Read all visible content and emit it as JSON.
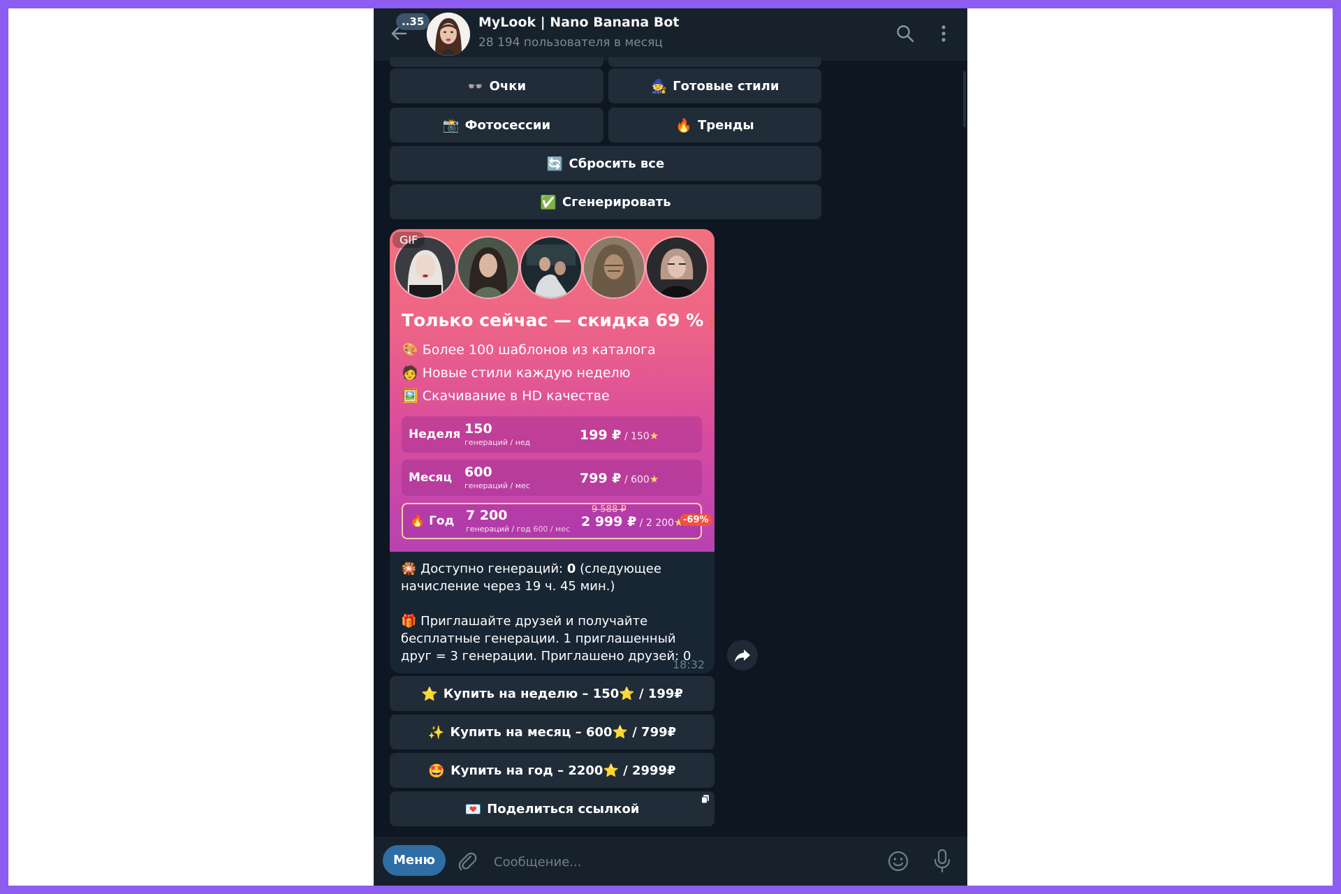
{
  "header": {
    "back_icon": "arrow-left-icon",
    "unread_count": "..35",
    "title": "MyLook | Nano Banana Bot",
    "subtitle": "28 194 пользователя в месяц",
    "search_icon": "search-icon",
    "more_icon": "vertical-dots-icon"
  },
  "keyboard_top": [
    {
      "emoji": "👓",
      "label": "Очки"
    },
    {
      "emoji": "🧙",
      "label": "Готовые стили"
    },
    {
      "emoji": "📸",
      "label": "Фотосессии"
    },
    {
      "emoji": "🔥",
      "label": "Тренды"
    },
    {
      "emoji": "🔄",
      "label": "Сбросить все"
    },
    {
      "emoji": "✅",
      "label": "Сгенерировать"
    }
  ],
  "message": {
    "gif_label": "GIF",
    "promo_title": "Только сейчас — скидка 69 %",
    "promo_title_emoji": "💥",
    "features": [
      {
        "emoji": "🎨",
        "text": "Более 100 шаблонов из каталога"
      },
      {
        "emoji": "🧑",
        "text": "Новые стили каждую неделю"
      },
      {
        "emoji": "🖼️",
        "text": "Скачивание в HD качестве"
      }
    ],
    "plans": [
      {
        "name": "Неделя",
        "qty": "150",
        "sub": "генераций / нед",
        "sub_extra": "",
        "price": "199 ₽",
        "per": " / 150",
        "star": "★",
        "old_price": "",
        "discount": ""
      },
      {
        "name": "Месяц",
        "qty": "600",
        "sub": "генераций / мес",
        "sub_extra": "",
        "price": "799 ₽",
        "per": " / 600",
        "star": "★",
        "old_price": "",
        "discount": ""
      },
      {
        "name": "🔥 Год",
        "qty": "7 200",
        "sub": "генераций / год",
        "sub_extra": " 600 / мес",
        "price": "2 999 ₽",
        "per": " / 2 200",
        "star": "★",
        "old_price": "9 588 ₽",
        "discount": "-69%"
      }
    ],
    "available_emoji": "🎇",
    "available_text": "Доступно генераций:",
    "available_count": "0",
    "available_tail": "(следующее начисление через 19 ч. 45 мин.)",
    "invite_emoji": "🎁",
    "invite_text": "Приглашайте друзей и получайте бесплатные генерации. 1 приглашенный друг = 3 генерации. Приглашено друзей: 0",
    "time": "18:32"
  },
  "keyboard_bottom": [
    {
      "emoji": "⭐",
      "label": "Купить на неделю – 150⭐ / 199₽"
    },
    {
      "emoji": "✨",
      "label": "Купить на месяц – 600⭐ / 799₽"
    },
    {
      "emoji": "🤩",
      "label": "Купить на год – 2200⭐ / 2999₽"
    },
    {
      "emoji": "💌",
      "label": "Поделиться ссылкой"
    }
  ],
  "input_bar": {
    "menu_label": "Меню",
    "placeholder": "Сообщение...",
    "attach_icon": "paperclip-icon",
    "emoji_icon": "smiley-icon",
    "mic_icon": "microphone-icon"
  },
  "colors": {
    "background": "#0e1621",
    "header": "#17212b",
    "button": "#202c38",
    "accent": "#2f6ea5",
    "frame": "#8d5cf0"
  }
}
